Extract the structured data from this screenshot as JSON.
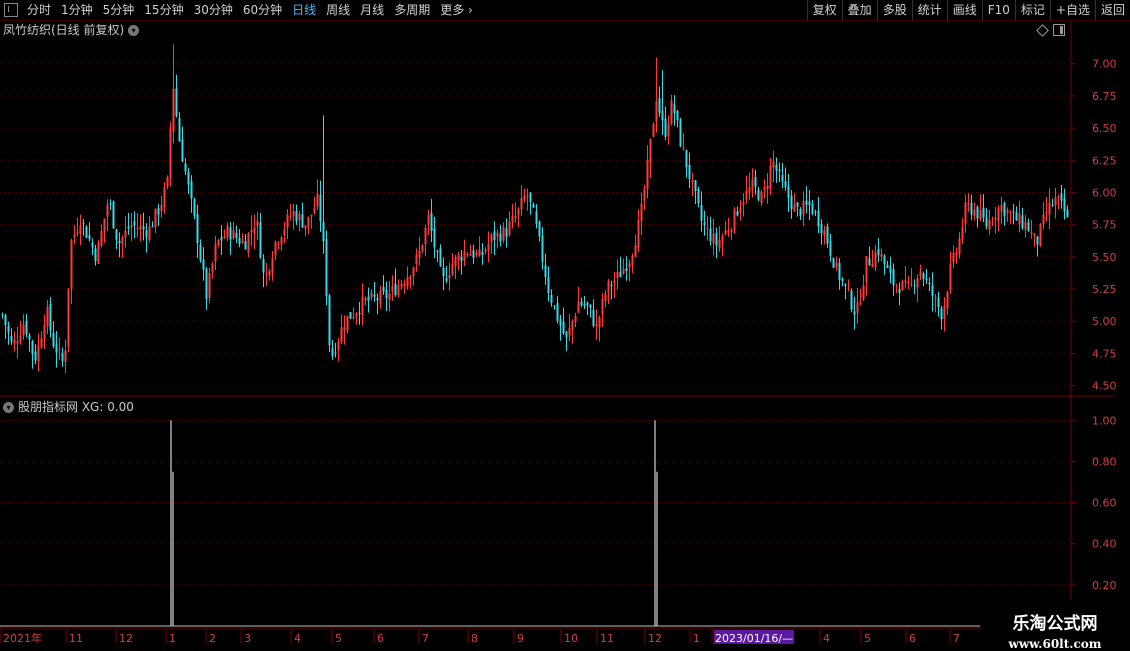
{
  "toolbar": {
    "periods": [
      {
        "label": "分时",
        "active": false
      },
      {
        "label": "1分钟",
        "active": false
      },
      {
        "label": "5分钟",
        "active": false
      },
      {
        "label": "15分钟",
        "active": false
      },
      {
        "label": "30分钟",
        "active": false
      },
      {
        "label": "60分钟",
        "active": false
      },
      {
        "label": "日线",
        "active": true
      },
      {
        "label": "周线",
        "active": false
      },
      {
        "label": "月线",
        "active": false
      },
      {
        "label": "多周期",
        "active": false
      },
      {
        "label": "更多",
        "active": false
      }
    ],
    "right_buttons": [
      "复权",
      "叠加",
      "多股",
      "统计",
      "画线",
      "F10",
      "标记",
      "+自选",
      "返回"
    ]
  },
  "main_title": "凤竹纺织(日线 前复权)",
  "indicator_title": "股朋指标网 XG: 0.00",
  "watermark": {
    "name": "乐淘公式网",
    "url": "www.60lt.com"
  },
  "colors": {
    "up": "#ff3a3a",
    "down": "#37d9e6",
    "axis": "#7a0000",
    "grid": "#5a0000",
    "xg": "#ffffff",
    "active": "#4fb4ff",
    "cursor_bg": "#5a1aa0"
  },
  "chart_data": [
    {
      "type": "candlestick",
      "title": "凤竹纺织(日线 前复权)",
      "ylim": [
        4.45,
        7.2
      ],
      "y_ticks": [
        "7.00",
        "6.75",
        "6.50",
        "6.25",
        "6.00",
        "5.75",
        "5.50",
        "5.25",
        "5.00",
        "4.75",
        "4.50"
      ],
      "grid": true,
      "anchors": [
        [
          0,
          5.1
        ],
        [
          12,
          4.8
        ],
        [
          24,
          5.0
        ],
        [
          34,
          4.7
        ],
        [
          38,
          4.8
        ],
        [
          46,
          5.1
        ],
        [
          52,
          4.85
        ],
        [
          64,
          4.65
        ],
        [
          70,
          5.6
        ],
        [
          80,
          5.8
        ],
        [
          96,
          5.5
        ],
        [
          108,
          5.95
        ],
        [
          118,
          5.6
        ],
        [
          130,
          5.75
        ],
        [
          148,
          5.7
        ],
        [
          160,
          5.9
        ],
        [
          168,
          6.1
        ],
        [
          172,
          6.9
        ],
        [
          178,
          6.45
        ],
        [
          184,
          6.2
        ],
        [
          196,
          5.7
        ],
        [
          206,
          5.2
        ],
        [
          216,
          5.6
        ],
        [
          228,
          5.7
        ],
        [
          244,
          5.6
        ],
        [
          256,
          5.8
        ],
        [
          264,
          5.3
        ],
        [
          274,
          5.6
        ],
        [
          292,
          5.85
        ],
        [
          306,
          5.75
        ],
        [
          318,
          5.95
        ],
        [
          324,
          5.5
        ],
        [
          330,
          4.7
        ],
        [
          344,
          5.0
        ],
        [
          364,
          5.15
        ],
        [
          388,
          5.2
        ],
        [
          406,
          5.35
        ],
        [
          418,
          5.5
        ],
        [
          428,
          5.8
        ],
        [
          442,
          5.3
        ],
        [
          452,
          5.45
        ],
        [
          466,
          5.55
        ],
        [
          480,
          5.5
        ],
        [
          492,
          5.65
        ],
        [
          506,
          5.7
        ],
        [
          518,
          5.85
        ],
        [
          526,
          6.0
        ],
        [
          534,
          5.8
        ],
        [
          548,
          5.25
        ],
        [
          556,
          5.05
        ],
        [
          566,
          4.85
        ],
        [
          578,
          5.15
        ],
        [
          588,
          5.1
        ],
        [
          596,
          4.95
        ],
        [
          606,
          5.25
        ],
        [
          618,
          5.35
        ],
        [
          630,
          5.5
        ],
        [
          640,
          5.8
        ],
        [
          648,
          6.25
        ],
        [
          656,
          6.75
        ],
        [
          664,
          6.45
        ],
        [
          672,
          6.7
        ],
        [
          680,
          6.4
        ],
        [
          690,
          6.1
        ],
        [
          702,
          5.75
        ],
        [
          716,
          5.6
        ],
        [
          730,
          5.75
        ],
        [
          742,
          5.95
        ],
        [
          752,
          6.05
        ],
        [
          762,
          5.95
        ],
        [
          772,
          6.25
        ],
        [
          782,
          6.05
        ],
        [
          796,
          5.85
        ],
        [
          810,
          5.9
        ],
        [
          824,
          5.7
        ],
        [
          836,
          5.4
        ],
        [
          848,
          5.2
        ],
        [
          856,
          5.05
        ],
        [
          866,
          5.45
        ],
        [
          878,
          5.55
        ],
        [
          892,
          5.3
        ],
        [
          908,
          5.25
        ],
        [
          920,
          5.4
        ],
        [
          932,
          5.2
        ],
        [
          942,
          5.05
        ],
        [
          950,
          5.4
        ],
        [
          958,
          5.6
        ],
        [
          966,
          5.9
        ],
        [
          976,
          5.85
        ],
        [
          986,
          5.75
        ],
        [
          1000,
          5.9
        ],
        [
          1014,
          5.8
        ],
        [
          1026,
          5.75
        ],
        [
          1036,
          5.6
        ],
        [
          1046,
          5.85
        ],
        [
          1056,
          5.95
        ],
        [
          1064,
          5.85
        ],
        [
          1070,
          5.7
        ]
      ],
      "spikes": [
        [
          172,
          7.15
        ],
        [
          656,
          7.05
        ],
        [
          662,
          6.95
        ],
        [
          322,
          6.6
        ]
      ]
    },
    {
      "type": "bar",
      "title": "股朋指标网 XG: 0.00",
      "series": [
        {
          "name": "XG",
          "values": [
            {
              "x": 171,
              "value": 1.0
            },
            {
              "x": 655,
              "value": 1.0
            }
          ]
        }
      ],
      "ylim": [
        0,
        1.05
      ],
      "y_ticks": [
        "1.00",
        "0.80",
        "0.60",
        "0.40",
        "0.20"
      ],
      "grid": true
    }
  ],
  "x_axis": {
    "labels": [
      "2021年",
      "11",
      "12",
      "1",
      "2",
      "3",
      "4",
      "5",
      "6",
      "7",
      "8",
      "9",
      "10",
      "11",
      "12",
      "1",
      "2023/01/16/—",
      "4",
      "5",
      "6",
      "7"
    ],
    "cursor_label": "2023/01/16/—"
  }
}
